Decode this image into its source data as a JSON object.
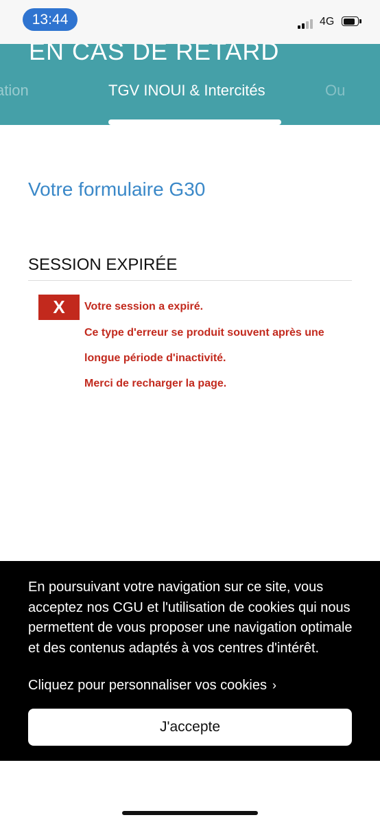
{
  "status_bar": {
    "time": "13:44",
    "network": "4G",
    "icons": [
      "signal-icon",
      "battery-icon"
    ]
  },
  "header": {
    "title": "EN CAS DE RETARD",
    "tabs": [
      {
        "label": "ation",
        "state": "partial-left"
      },
      {
        "label": "TGV INOUI & Intercités",
        "state": "active"
      },
      {
        "label": "Ou",
        "state": "partial-right"
      }
    ]
  },
  "main": {
    "form_title": "Votre formulaire G30",
    "section_title": "SESSION EXPIRÉE",
    "error": {
      "badge": "X",
      "lines": [
        "Votre session a expiré.",
        "Ce type d'erreur se produit souvent après une",
        "longue période d'inactivité.",
        "Merci de recharger la page."
      ]
    }
  },
  "cookie_banner": {
    "text": "En poursuivant votre navigation sur ce site, vous acceptez nos CGU et l'utilisation de cookies qui nous permettent de vous proposer une navigation optimale et des contenus adaptés à vos centres d'intérêt.",
    "link": "Cliquez pour personnaliser vos cookies",
    "accept_label": "J'accepte"
  },
  "colors": {
    "header_bg": "#45a0a8",
    "title_blue": "#3a88c8",
    "error_red": "#c2291d",
    "banner_bg": "#000000"
  }
}
